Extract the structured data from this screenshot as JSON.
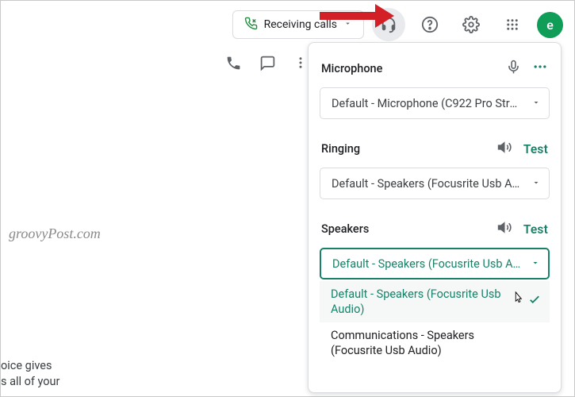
{
  "header": {
    "call_chip_label": "Receiving calls",
    "avatar_letter": "e"
  },
  "watermark": "groovyPost.com",
  "body_fragment": {
    "l1": "oice gives",
    "l2": "s all of your"
  },
  "audio_panel": {
    "mic": {
      "label": "Microphone",
      "value": "Default - Microphone (C922 Pro Strea…"
    },
    "ring": {
      "label": "Ringing",
      "test": "Test",
      "value": "Default - Speakers (Focusrite Usb Aud…"
    },
    "spk": {
      "label": "Speakers",
      "test": "Test",
      "value": "Default - Speakers (Focusrite Usb Aud…",
      "options": [
        "Default - Speakers (Focusrite Usb Audio)",
        "Communications - Speakers (Focusrite Usb Audio)"
      ]
    }
  }
}
